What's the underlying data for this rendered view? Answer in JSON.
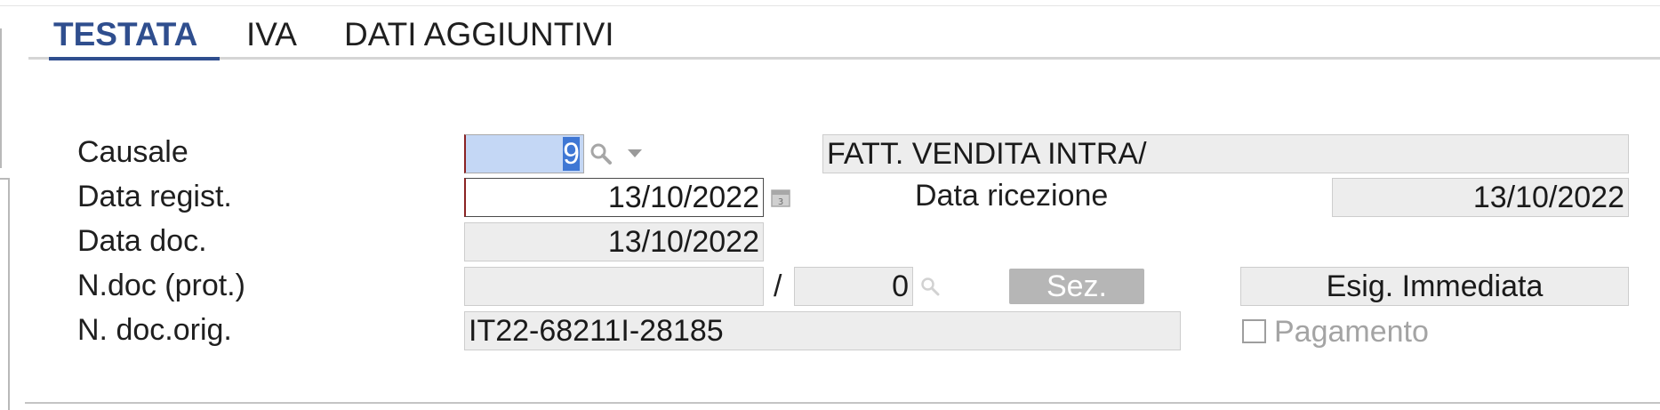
{
  "tabs": [
    "TESTATA",
    "IVA",
    "DATI AGGIUNTIVI"
  ],
  "labels": {
    "causale": "Causale",
    "data_regist": "Data regist.",
    "data_doc": "Data doc.",
    "ndoc_prot": "N.doc (prot.)",
    "ndoc_orig": "N. doc.orig.",
    "data_ricezione": "Data ricezione",
    "slash": "/"
  },
  "fields": {
    "causale_value": "9",
    "causale_desc": "FATT. VENDITA INTRA/",
    "data_regist": "13/10/2022",
    "data_ricezione": "13/10/2022",
    "data_doc": "13/10/2022",
    "ndoc_prot": "",
    "ndoc_num": "0",
    "ndoc_orig": "IT22-68211I-28185"
  },
  "buttons": {
    "sez": "Sez.",
    "esig": "Esig. Immediata"
  },
  "checkbox": {
    "pagamento_label": "Pagamento",
    "pagamento_checked": false
  },
  "icons": {
    "causale_search": "magnifier-icon",
    "causale_dropdown": "triangle-down-icon",
    "calendar": "calendar-icon",
    "ndoc_search": "magnifier-icon"
  },
  "colors": {
    "active_tab": "#2f4e8e",
    "required_marker": "#8b2323",
    "selection": "#3f77d4"
  }
}
